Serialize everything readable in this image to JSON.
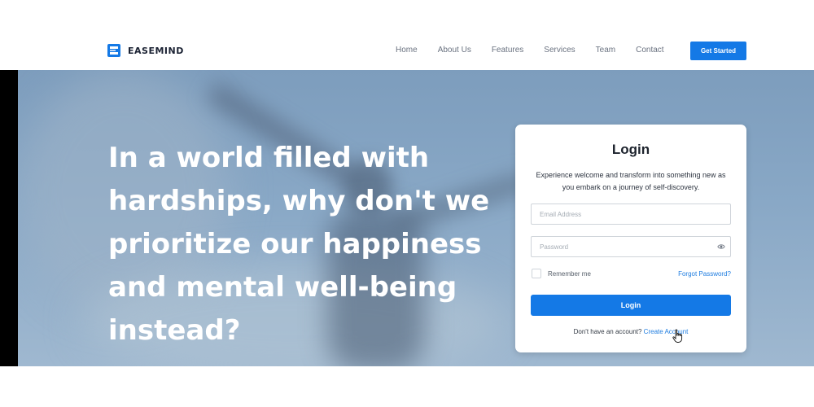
{
  "brand": {
    "name": "EASEMIND",
    "logo_icon": "easemind-logo-icon"
  },
  "nav": {
    "links": [
      "Home",
      "About Us",
      "Features",
      "Services",
      "Team",
      "Contact"
    ],
    "cta_label": "Get Started"
  },
  "hero": {
    "headline_lines": [
      "In a world filled with",
      "hardships, why don't we",
      "prioritize our happiness",
      "and mental well-being",
      "instead?"
    ]
  },
  "login": {
    "title": "Login",
    "subtitle": "Experience welcome and transform into something new as you embark on a journey of self-discovery.",
    "email_placeholder": "Email Address",
    "password_placeholder": "Password",
    "password_toggle_icon": "eye-icon",
    "remember_label": "Remember me",
    "forgot_label": "Forgot Password?",
    "button_label": "Login",
    "signup_prompt": "Don't have an account?",
    "signup_link": "Create Account"
  },
  "colors": {
    "accent": "#1479e6",
    "link": "#1f7de0",
    "hero_bg": "#89a8c6"
  }
}
